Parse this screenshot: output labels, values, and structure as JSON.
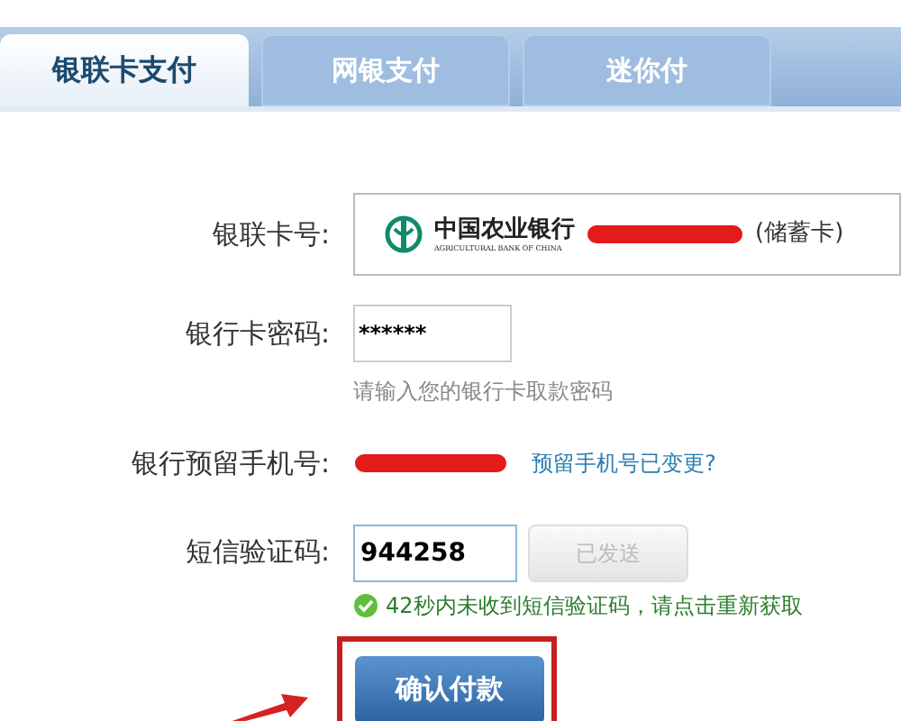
{
  "tabs": [
    {
      "label": "银联卡支付",
      "selected": true
    },
    {
      "label": "网银支付",
      "selected": false
    },
    {
      "label": "迷你付",
      "selected": false
    }
  ],
  "form": {
    "card": {
      "label": "银联卡号:",
      "bank_name": "中国农业银行",
      "bank_name_en": "AGRICULTURAL BANK OF CHINA",
      "card_type": "(储蓄卡)"
    },
    "password": {
      "label": "银行卡密码:",
      "value": "******",
      "hint": "请输入您的银行卡取款密码"
    },
    "phone": {
      "label": "银行预留手机号:",
      "link": "预留手机号已变更?"
    },
    "sms": {
      "label": "短信验证码:",
      "value": "944258",
      "send_button": "已发送",
      "send_disabled": true,
      "notice": "42秒内未收到短信验证码，请点击重新获取"
    },
    "confirm_button": "确认付款"
  }
}
